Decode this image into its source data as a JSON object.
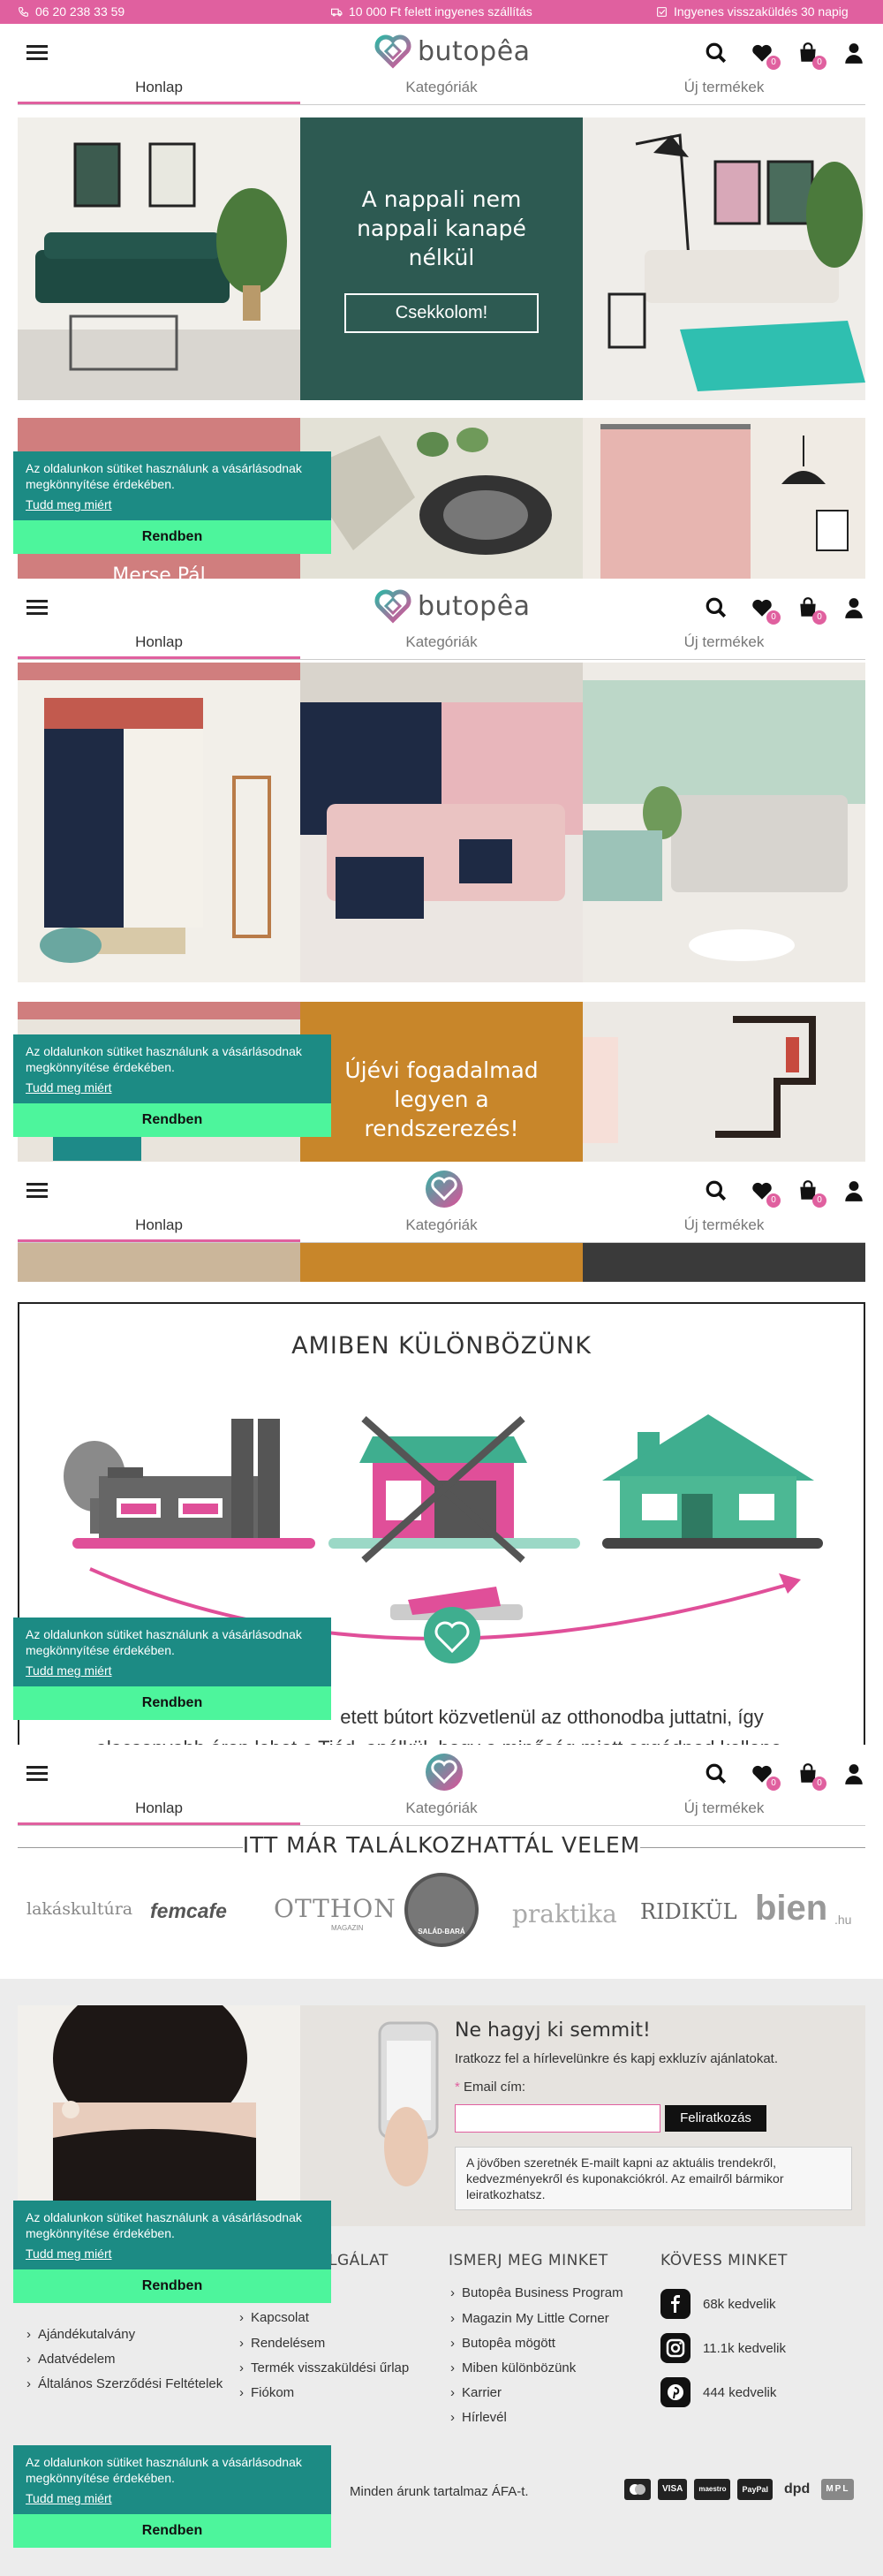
{
  "topbar": {
    "phone": "06 20 238 33 59",
    "shipping": "10 000 Ft felett ingyenes szállítás",
    "returns": "Ingyenes visszaküldés 30 napig"
  },
  "header": {
    "logo_text": "butopêa",
    "tabs": [
      "Honlap",
      "Kategóriák",
      "Új termékek"
    ],
    "wishlist_count": "0",
    "cart_count": "0"
  },
  "hero": {
    "title": "A nappali nem nappali kanapé nélkül",
    "button": "Csekkolom!"
  },
  "tiles": {
    "partial_name": "Merse Pál",
    "promo2_title": "Újévi fogadalmad legyen a rendszerezés!"
  },
  "cookie": {
    "text": "Az oldalunkon sütiket használunk a vásárlásodnak megkönnyítése érdekében.",
    "link": "Tudd meg miért",
    "button": "Rendben"
  },
  "feature": {
    "title": "AMIBEN KÜLÖNBÖZÜNK",
    "text_line1": "etett bútort közvetlenül az otthonodba juttatni, így",
    "text_line2": "alacsonyabb áron lehet a Tiéd, anélkül, hogy a minőség miatt aggódnod kellene."
  },
  "press": {
    "title": "ITT MÁR TALÁLKOZHATTÁL VELEM",
    "logos": [
      "lakáskultúra",
      "femcafe",
      "OTTHON",
      "MAGAZIN",
      "SALÁD-BARÁ",
      "praktika",
      "RIDIKÜL",
      "bien",
      ".hu"
    ]
  },
  "newsletter": {
    "title": "Ne hagyj ki semmit!",
    "subtitle": "Iratkozz fel a hírlevelünkre és kapj exkluzív ajánlatokat.",
    "email_label": "Email cím:",
    "email_placeholder": "",
    "button": "Feliratkozás",
    "optin": "A jövőben szeretnék E-mailt kapni az aktuális trendekről, kedvezményekről és kuponakciókról. Az emailről bármikor leiratkozhatsz."
  },
  "footer": {
    "col2_title_partial": "LGÁLAT",
    "col3_title": "ISMERJ MEG MINKET",
    "col4_title": "KÖVESS MINKET",
    "col1_links": [
      "Ajándékutalvány",
      "Adatvédelem",
      "Általános Szerződési Feltételek"
    ],
    "col2_links": [
      "Kapcsolat",
      "Rendelésem",
      "Termék visszaküldési űrlap",
      "Fiókom"
    ],
    "col3_links": [
      "Butopêa Business Program",
      "Magazin My Little Corner",
      "Butopêa mögött",
      "Miben különbözünk",
      "Karrier",
      "Hírlevél"
    ],
    "social": [
      {
        "icon": "facebook-icon",
        "label": "68k kedvelik"
      },
      {
        "icon": "instagram-icon",
        "label": "11.1k kedvelik"
      },
      {
        "icon": "pinterest-icon",
        "label": "444 kedvelik"
      }
    ],
    "vat_note": "Minden árunk tartalmaz ÁFA-t.",
    "payment_logos": [
      "mastercard",
      "VISA",
      "maestro",
      "PayPal",
      "dpd",
      "MPL"
    ]
  },
  "colors": {
    "brand_pink": "#e0609f",
    "brand_teal": "#1c8b84",
    "hero_green": "#2d5a52",
    "cookie_button": "#4df59c",
    "promo_orange": "#c8862a"
  }
}
